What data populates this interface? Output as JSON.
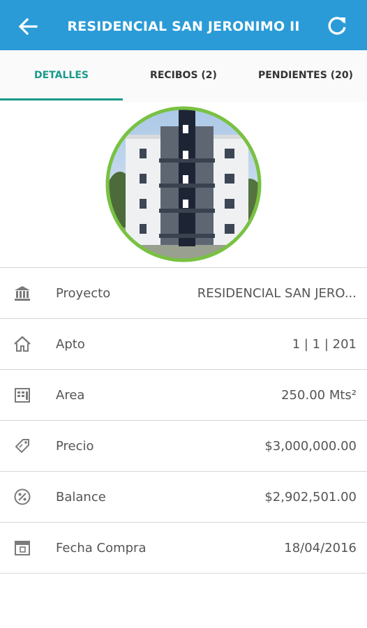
{
  "header": {
    "title": "RESIDENCIAL SAN JERONIMO II",
    "back_icon": "arrow-left-icon",
    "refresh_icon": "refresh-icon",
    "color": "#2a9bd7"
  },
  "tabs": [
    {
      "label": "DETALLES",
      "active": true
    },
    {
      "label": "RECIBOS (2)",
      "active": false
    },
    {
      "label": "PENDIENTES (20)",
      "active": false
    }
  ],
  "accent_color": "#1a9a8a",
  "avatar_ring_color": "#79c142",
  "details": [
    {
      "icon": "bank-icon",
      "label": "Proyecto",
      "value": "RESIDENCIAL SAN JERO..."
    },
    {
      "icon": "home-icon",
      "label": "Apto",
      "value": "1 | 1 | 201"
    },
    {
      "icon": "building-icon",
      "label": "Area",
      "value": "250.00 Mts²"
    },
    {
      "icon": "price-tag-icon",
      "label": "Precio",
      "value": "$3,000,000.00"
    },
    {
      "icon": "percent-icon",
      "label": "Balance",
      "value": "$2,902,501.00"
    },
    {
      "icon": "calendar-icon",
      "label": "Fecha Compra",
      "value": "18/04/2016"
    }
  ]
}
